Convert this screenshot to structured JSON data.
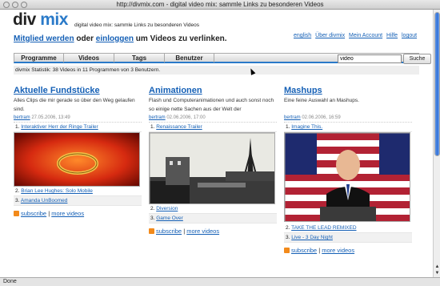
{
  "window": {
    "title": "http://divmix.com - digital video mix: sammle Links zu besonderen Videos"
  },
  "header": {
    "logo_div": "div",
    "logo_mix": "mix",
    "tagline": "digital video mix: sammle Links zu besonderen Videos",
    "join_link_register": "Mitglied werden",
    "join_or": " oder ",
    "join_link_login": "einloggen",
    "join_rest": " um Videos zu verlinken.",
    "links": [
      "english",
      "Über divmix",
      "Mein Account",
      "Hilfe",
      "logout"
    ]
  },
  "nav": {
    "tabs": [
      "Programme",
      "Videos",
      "Tags",
      "Benutzer"
    ],
    "search_value": "video",
    "search_button": "Suche",
    "stats": "divmix Statistik: 38 Videos in 11 Programmen von 3 Benutzern."
  },
  "columns": [
    {
      "title": "Aktuelle Fundstücke",
      "description": "Alles Clips die mir gerade so über den Weg gelaufen sind.",
      "user": "bertram",
      "date": "27.05.2006, 13:49",
      "items": [
        {
          "num": "1.",
          "label": "Interaktiver Herr der Ringe Trailer"
        },
        {
          "num": "2.",
          "label": "Brian Lee Hughes: Solo Mobile"
        },
        {
          "num": "3.",
          "label": "Amanda UnBoomed"
        }
      ],
      "subscribe": "subscribe",
      "more": "more videos"
    },
    {
      "title": "Animationen",
      "description": "Flash und Computeranimationen und auch sonst noch so einige nette Sachen aus der Welt der",
      "user": "bertram",
      "date": "02.06.2006, 17:00",
      "items": [
        {
          "num": "1.",
          "label": "Renaissance Trailer"
        },
        {
          "num": "2.",
          "label": "Diversion"
        },
        {
          "num": "3.",
          "label": "Game Over"
        }
      ],
      "subscribe": "subscribe",
      "more": "more videos"
    },
    {
      "title": "Mashups",
      "description": "Eine feine Auswahl an Mashups.",
      "user": "bertram",
      "date": "02.06.2006, 16:59",
      "items": [
        {
          "num": "1.",
          "label": "Imagine This."
        },
        {
          "num": "2.",
          "label": "TAKE THE LEAD REMIXED"
        },
        {
          "num": "3.",
          "label": "Live - 3 Day Night"
        }
      ],
      "subscribe": "subscribe",
      "more": "more videos"
    }
  ],
  "status": {
    "text": "Done"
  },
  "colors": {
    "brand_blue": "#2a7ac9",
    "link": "#1560b6",
    "rss": "#f28a1b"
  }
}
